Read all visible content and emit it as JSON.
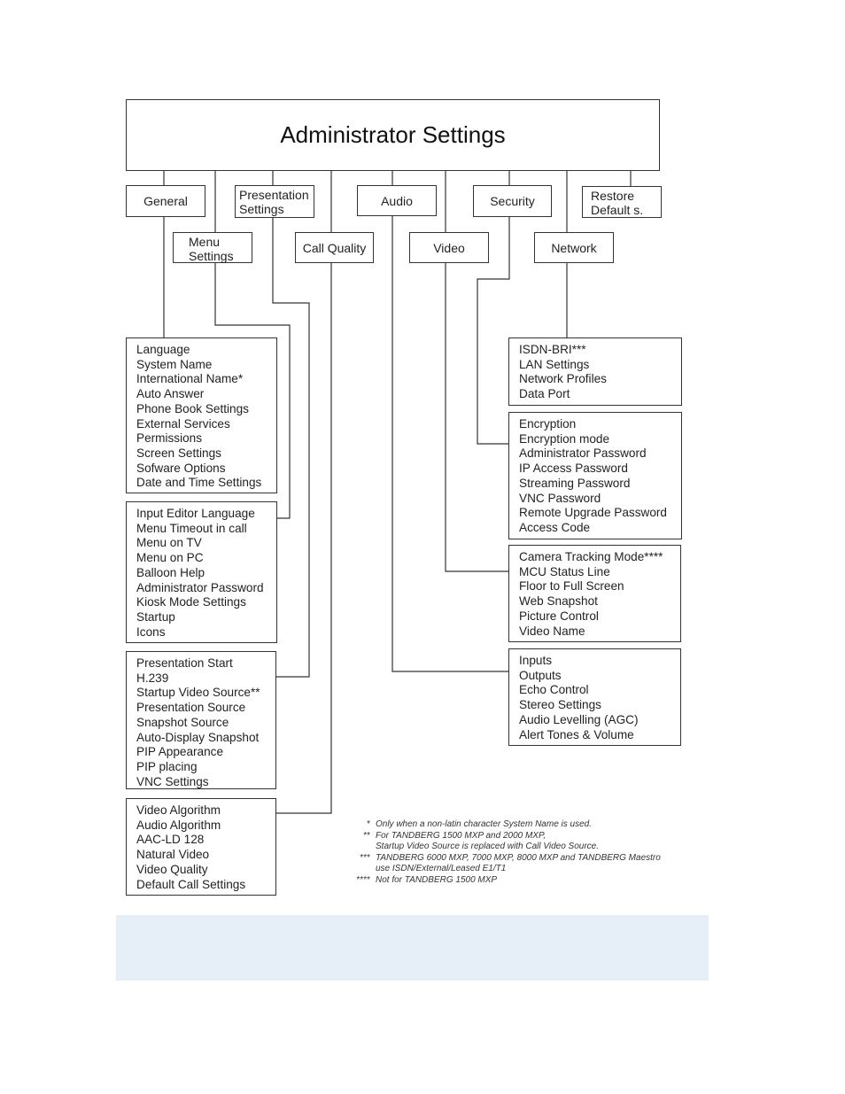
{
  "title": "Administrator Settings",
  "categories": {
    "general": "General",
    "menu_settings": [
      "Menu",
      "Settings"
    ],
    "presentation_settings": [
      "Presentation",
      "Settings"
    ],
    "call_quality": "Call Quality",
    "audio": "Audio",
    "video": "Video",
    "security": "Security",
    "network": "Network",
    "restore_defaults": [
      "Restore",
      "Default s."
    ]
  },
  "lists": {
    "general": [
      "Language",
      "System Name",
      "International Name*",
      "Auto Answer",
      "Phone Book Settings",
      "External Services",
      "Permissions",
      "Screen Settings",
      "Sofware Options",
      "Date and Time Settings"
    ],
    "menu_settings": [
      "Input Editor Language",
      "Menu Timeout in call",
      "Menu on TV",
      "Menu on PC",
      "Balloon Help",
      "Administrator Password",
      "Kiosk Mode Settings",
      "Startup",
      "Icons"
    ],
    "presentation_settings": [
      "Presentation Start",
      "H.239",
      "Startup Video Source**",
      "Presentation Source",
      "Snapshot Source",
      "Auto-Display Snapshot",
      "PIP Appearance",
      "PIP placing",
      "VNC Settings"
    ],
    "call_quality": [
      "Video Algorithm",
      "Audio Algorithm",
      "AAC-LD 128",
      "Natural Video",
      "Video Quality",
      "Default Call Settings"
    ],
    "network": [
      "ISDN-BRI***",
      "LAN Settings",
      "Network Profiles",
      "Data Port"
    ],
    "security": [
      "Encryption",
      "Encryption mode",
      "Administrator Password",
      "IP Access Password",
      "Streaming Password",
      "VNC Password",
      "Remote Upgrade Password",
      "Access Code"
    ],
    "video": [
      "Camera Tracking Mode****",
      "MCU Status Line",
      "Floor to Full Screen",
      "Web Snapshot",
      "Picture Control",
      "Video Name"
    ],
    "audio": [
      "Inputs",
      "Outputs",
      "Echo Control",
      "Stereo Settings",
      "Audio Levelling (AGC)",
      "Alert Tones & Volume"
    ]
  },
  "footnotes": [
    {
      "mark": "*",
      "lines": [
        "Only when a non-latin character System Name is used."
      ]
    },
    {
      "mark": "**",
      "lines": [
        "For TANDBERG 1500 MXP and 2000 MXP,",
        "Startup Video Source is replaced with Call Video Source."
      ]
    },
    {
      "mark": "***",
      "lines": [
        "TANDBERG 6000 MXP, 7000 MXP, 8000 MXP and TANDBERG Maestro",
        "use ISDN/External/Leased E1/T1"
      ]
    },
    {
      "mark": "****",
      "lines": [
        "Not for TANDBERG 1500 MXP"
      ]
    }
  ],
  "colors": {
    "line": "#333333",
    "banner": "#e6eef7"
  }
}
